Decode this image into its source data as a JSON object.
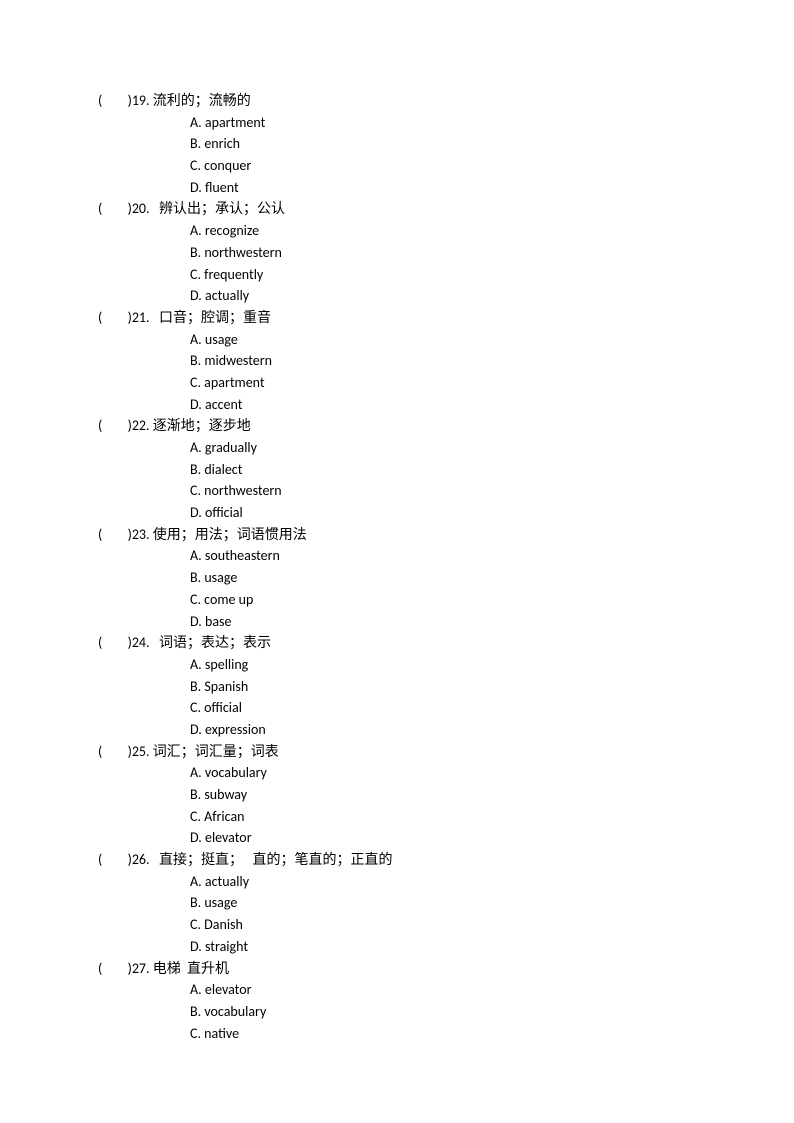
{
  "questions": [
    {
      "number": "19",
      "prompt": "流利的；流畅的",
      "options": [
        {
          "letter": "A",
          "text": "apartment"
        },
        {
          "letter": "B",
          "text": "enrich"
        },
        {
          "letter": "C",
          "text": "conquer"
        },
        {
          "letter": "D",
          "text": "fluent"
        }
      ]
    },
    {
      "number": "20",
      "prompt": "  辨认出；承认；公认",
      "options": [
        {
          "letter": "A",
          "text": "recognize"
        },
        {
          "letter": "B",
          "text": "northwestern"
        },
        {
          "letter": "C",
          "text": "frequently"
        },
        {
          "letter": "D",
          "text": "actually"
        }
      ]
    },
    {
      "number": "21",
      "prompt": "  口音；腔调；重音",
      "options": [
        {
          "letter": "A",
          "text": "usage"
        },
        {
          "letter": "B",
          "text": "midwestern"
        },
        {
          "letter": "C",
          "text": "apartment"
        },
        {
          "letter": "D",
          "text": "accent"
        }
      ]
    },
    {
      "number": "22",
      "prompt": "逐渐地；逐步地",
      "options": [
        {
          "letter": "A",
          "text": "gradually"
        },
        {
          "letter": "B",
          "text": "dialect"
        },
        {
          "letter": "C",
          "text": "northwestern"
        },
        {
          "letter": "D",
          "text": "official"
        }
      ]
    },
    {
      "number": "23",
      "prompt": "使用；用法；词语惯用法",
      "options": [
        {
          "letter": "A",
          "text": "southeastern"
        },
        {
          "letter": "B",
          "text": "usage"
        },
        {
          "letter": "C",
          "text": "come up"
        },
        {
          "letter": "D",
          "text": "base"
        }
      ]
    },
    {
      "number": "24",
      "prompt": "  词语；表达；表示",
      "options": [
        {
          "letter": "A",
          "text": "spelling"
        },
        {
          "letter": "B",
          "text": "Spanish"
        },
        {
          "letter": "C",
          "text": "official"
        },
        {
          "letter": "D",
          "text": "expression"
        }
      ]
    },
    {
      "number": "25",
      "prompt": "词汇；词汇量；词表",
      "options": [
        {
          "letter": "A",
          "text": "vocabulary"
        },
        {
          "letter": "B",
          "text": "subway"
        },
        {
          "letter": "C",
          "text": "African"
        },
        {
          "letter": "D",
          "text": "elevator"
        }
      ]
    },
    {
      "number": "26",
      "prompt": "  直接；挺直；   直的；笔直的；正直的",
      "options": [
        {
          "letter": "A",
          "text": "actually"
        },
        {
          "letter": "B",
          "text": "usage"
        },
        {
          "letter": "C",
          "text": "Danish"
        },
        {
          "letter": "D",
          "text": "straight"
        }
      ]
    },
    {
      "number": "27",
      "prompt": "电梯  直升机",
      "options": [
        {
          "letter": "A",
          "text": "elevator"
        },
        {
          "letter": "B",
          "text": "vocabulary"
        },
        {
          "letter": "C",
          "text": "native"
        }
      ]
    }
  ],
  "paren_open": "(",
  "paren_close": ")",
  "option_sep": ". "
}
